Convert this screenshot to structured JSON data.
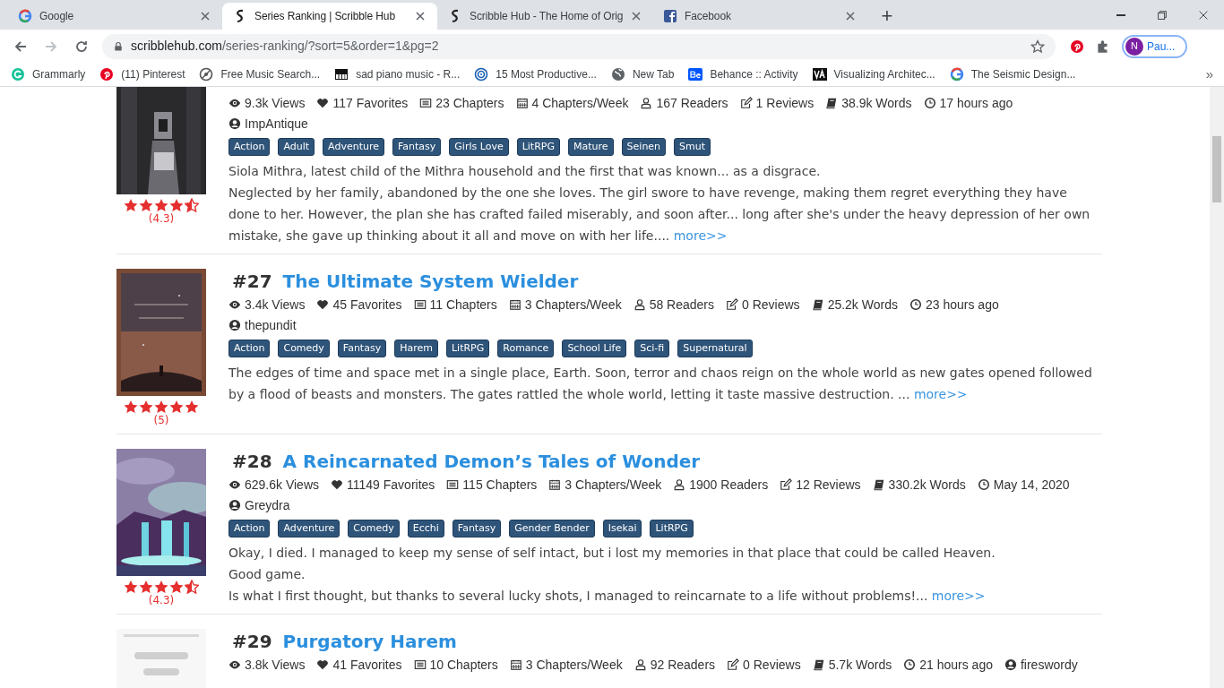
{
  "tabs": [
    {
      "label": "Google",
      "selected": false
    },
    {
      "label": "Series Ranking | Scribble Hub",
      "selected": true
    },
    {
      "label": "Scribble Hub - The Home of Orig",
      "selected": false
    },
    {
      "label": "Facebook",
      "selected": false
    }
  ],
  "new_tab": "+",
  "address": {
    "host": "scribblehub.com",
    "path": "/series-ranking/?sort=5&order=1&pg=2"
  },
  "profile": {
    "initial": "N",
    "name": "Pau..."
  },
  "bookmarks": [
    {
      "label": "Grammarly"
    },
    {
      "label": "(11) Pinterest"
    },
    {
      "label": "Free Music Search..."
    },
    {
      "label": "sad piano music - R..."
    },
    {
      "label": "15 Most Productive..."
    },
    {
      "label": "New Tab"
    },
    {
      "label": "Behance :: Activity"
    },
    {
      "label": "Visualizing Architec..."
    },
    {
      "label": "The Seismic Design..."
    }
  ],
  "bookmarks_more": "»",
  "series": [
    {
      "stars": 4.5,
      "rating": "(4.3)",
      "author_inline": false,
      "stats": [
        {
          "kind": "views",
          "text": "9.3k Views"
        },
        {
          "kind": "favorites",
          "text": "117 Favorites"
        },
        {
          "kind": "chapters",
          "text": "23 Chapters"
        },
        {
          "kind": "rate",
          "text": "4 Chapters/Week"
        },
        {
          "kind": "readers",
          "text": "167 Readers"
        },
        {
          "kind": "reviews",
          "text": "1 Reviews"
        },
        {
          "kind": "words",
          "text": "38.9k Words"
        },
        {
          "kind": "updated",
          "text": "17 hours ago"
        }
      ],
      "author": "ImpAntique",
      "tags": [
        "Action",
        "Adult",
        "Adventure",
        "Fantasy",
        "Girls Love",
        "LitRPG",
        "Mature",
        "Seinen",
        "Smut"
      ],
      "description": [
        "Siola Mithra, latest child of the Mithra household and the first that was known... as a disgrace.",
        "Neglected by her family, abandoned by the one she loves. The girl swore to have revenge, making them regret everything they have done to her. However, the plan she has crafted failed miserably, and soon after... long after she's under the heavy depression of her own mistake, she gave up thinking about it all and move on with her life...."
      ],
      "more": "more>>"
    },
    {
      "rank": "#27",
      "title": "The Ultimate System Wielder",
      "stars": 5,
      "rating": "(5)",
      "author_inline": false,
      "stats": [
        {
          "kind": "views",
          "text": "3.4k Views"
        },
        {
          "kind": "favorites",
          "text": "45 Favorites"
        },
        {
          "kind": "chapters",
          "text": "11 Chapters"
        },
        {
          "kind": "rate",
          "text": "3 Chapters/Week"
        },
        {
          "kind": "readers",
          "text": "58 Readers"
        },
        {
          "kind": "reviews",
          "text": "0 Reviews"
        },
        {
          "kind": "words",
          "text": "25.2k Words"
        },
        {
          "kind": "updated",
          "text": "23 hours ago"
        }
      ],
      "author": "thepundit",
      "tags": [
        "Action",
        "Comedy",
        "Fantasy",
        "Harem",
        "LitRPG",
        "Romance",
        "School Life",
        "Sci-fi",
        "Supernatural"
      ],
      "description": [
        "The edges of time and space met in a single place, Earth. Soon, terror and chaos reign on the whole world as new gates opened followed by a flood of beasts and monsters. The gates rattled the whole world, letting it taste massive destruction. ..."
      ],
      "more": "more>>"
    },
    {
      "rank": "#28",
      "title": "A Reincarnated Demon’s Tales of Wonder",
      "stars": 4.5,
      "rating": "(4.3)",
      "author_inline": false,
      "stats": [
        {
          "kind": "views",
          "text": "629.6k Views"
        },
        {
          "kind": "favorites",
          "text": "11149 Favorites"
        },
        {
          "kind": "chapters",
          "text": "115 Chapters"
        },
        {
          "kind": "rate",
          "text": "3 Chapters/Week"
        },
        {
          "kind": "readers",
          "text": "1900 Readers"
        },
        {
          "kind": "reviews",
          "text": "12 Reviews"
        },
        {
          "kind": "words",
          "text": "330.2k Words"
        },
        {
          "kind": "updated",
          "text": "May 14, 2020"
        }
      ],
      "author": "Greydra",
      "tags": [
        "Action",
        "Adventure",
        "Comedy",
        "Ecchi",
        "Fantasy",
        "Gender Bender",
        "Isekai",
        "LitRPG"
      ],
      "description": [
        "Okay, I died. I managed to keep my sense of self intact, but i lost my memories in that place that could be called Heaven.",
        "Good game.",
        "Is what I first thought, but thanks to several lucky shots, I managed to reincarnate to a life without problems!..."
      ],
      "more": "more>>"
    },
    {
      "rank": "#29",
      "title": "Purgatory Harem",
      "author_inline": true,
      "stats": [
        {
          "kind": "views",
          "text": "3.8k Views"
        },
        {
          "kind": "favorites",
          "text": "41 Favorites"
        },
        {
          "kind": "chapters",
          "text": "10 Chapters"
        },
        {
          "kind": "rate",
          "text": "3 Chapters/Week"
        },
        {
          "kind": "readers",
          "text": "92 Readers"
        },
        {
          "kind": "reviews",
          "text": "0 Reviews"
        },
        {
          "kind": "words",
          "text": "5.7k Words"
        },
        {
          "kind": "updated",
          "text": "21 hours ago"
        }
      ],
      "author": "fireswordy"
    }
  ]
}
